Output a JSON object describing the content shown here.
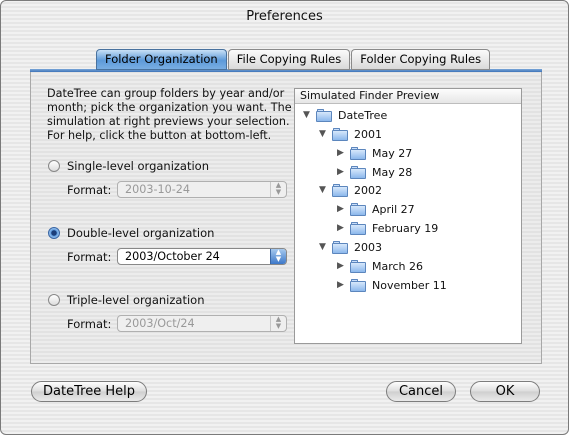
{
  "window": {
    "title": "Preferences"
  },
  "tabs": [
    {
      "label": "Folder Organization",
      "active": true
    },
    {
      "label": "File Copying Rules",
      "active": false
    },
    {
      "label": "Folder Copying Rules",
      "active": false
    }
  ],
  "description": "DateTree can group folders by year and/or month; pick the organization you want. The simulation at right previews your selection. For help, click the button at bottom-left.",
  "options": [
    {
      "label": "Single-level organization",
      "selected": false,
      "format_label": "Format:",
      "format_value": "2003-10-24",
      "enabled": false
    },
    {
      "label": "Double-level organization",
      "selected": true,
      "format_label": "Format:",
      "format_value": "2003/October 24",
      "enabled": true
    },
    {
      "label": "Triple-level organization",
      "selected": false,
      "format_label": "Format:",
      "format_value": "2003/Oct/24",
      "enabled": false
    }
  ],
  "preview": {
    "header": "Simulated Finder Preview",
    "items": [
      {
        "label": "DateTree",
        "level": 0,
        "expanded": true
      },
      {
        "label": "2001",
        "level": 1,
        "expanded": true
      },
      {
        "label": "May 27",
        "level": 2,
        "expanded": false
      },
      {
        "label": "May 28",
        "level": 2,
        "expanded": false
      },
      {
        "label": "2002",
        "level": 1,
        "expanded": true
      },
      {
        "label": "April 27",
        "level": 2,
        "expanded": false
      },
      {
        "label": "February 19",
        "level": 2,
        "expanded": false
      },
      {
        "label": "2003",
        "level": 1,
        "expanded": true
      },
      {
        "label": "March 26",
        "level": 2,
        "expanded": false
      },
      {
        "label": "November 11",
        "level": 2,
        "expanded": false
      }
    ]
  },
  "buttons": {
    "help": "DateTree Help",
    "cancel": "Cancel",
    "ok": "OK"
  }
}
